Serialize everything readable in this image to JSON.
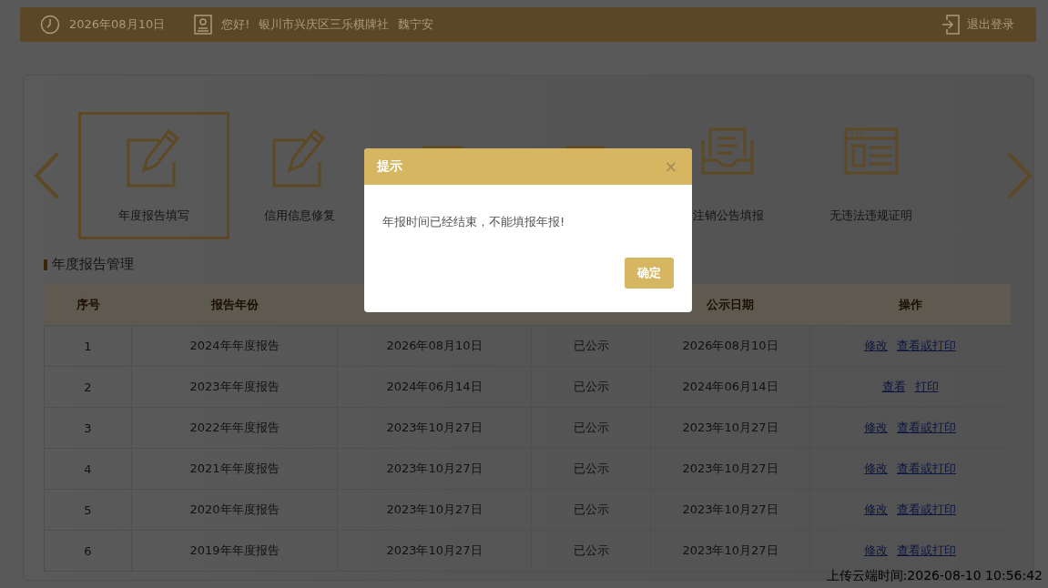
{
  "top_bar": {
    "date": "2026年08月10日",
    "greeting": "您好!",
    "company": "银川市兴庆区三乐棋牌社",
    "user": "魏宁安",
    "logout": "退出登录"
  },
  "carousel": {
    "items": [
      {
        "kind": "edit",
        "label": "年度报告填写",
        "selected": true
      },
      {
        "kind": "edit",
        "label": "信用信息修复",
        "selected": false
      },
      {
        "kind": "hidden",
        "selected": false
      },
      {
        "kind": "hidden",
        "selected": false
      },
      {
        "kind": "inbox",
        "label": "注销公告填报",
        "selected": false
      },
      {
        "kind": "form",
        "label": "无违法违规证明",
        "selected": false
      }
    ]
  },
  "section_title": "年度报告管理",
  "table": {
    "columns": [
      "序号",
      "报告年份",
      "",
      "",
      "公示日期",
      "操作"
    ],
    "rows": [
      {
        "cells": [
          "1",
          "2024年年度报告",
          "2026年08月10日",
          "已公示",
          "2026年08月10日"
        ],
        "actions": [
          "修改",
          "查看或打印"
        ]
      },
      {
        "cells": [
          "2",
          "2023年年度报告",
          "2024年06月14日",
          "已公示",
          "2024年06月14日"
        ],
        "actions": [
          "查看",
          "打印"
        ]
      },
      {
        "cells": [
          "3",
          "2022年年度报告",
          "2023年10月27日",
          "已公示",
          "2023年10月27日"
        ],
        "actions": [
          "修改",
          "查看或打印"
        ]
      },
      {
        "cells": [
          "4",
          "2021年年度报告",
          "2023年10月27日",
          "已公示",
          "2023年10月27日"
        ],
        "actions": [
          "修改",
          "查看或打印"
        ]
      },
      {
        "cells": [
          "5",
          "2020年年度报告",
          "2023年10月27日",
          "已公示",
          "2023年10月27日"
        ],
        "actions": [
          "修改",
          "查看或打印"
        ]
      },
      {
        "cells": [
          "6",
          "2019年年度报告",
          "2023年10月27日",
          "已公示",
          "2023年10月27日"
        ],
        "actions": [
          "修改",
          "查看或打印"
        ]
      }
    ]
  },
  "dialog": {
    "title": "提示",
    "close": "×",
    "message": "年报时间已经结束，不能填报年报!",
    "button": "确定"
  },
  "upload_time": "上传云端时间:2026-08-10 10:56:42"
}
